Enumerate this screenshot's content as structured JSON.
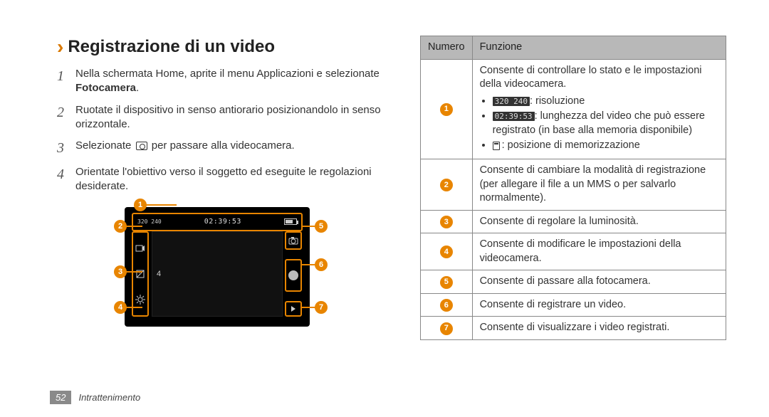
{
  "section": {
    "title": "Registrazione di un video"
  },
  "steps": [
    {
      "num": "1",
      "text_a": "Nella schermata Home, aprite il menu Applicazioni e selezionate ",
      "bold": "Fotocamera",
      "text_b": "."
    },
    {
      "num": "2",
      "text_a": "Ruotate il dispositivo in senso antiorario posizionandolo in senso orizzontale.",
      "bold": "",
      "text_b": ""
    },
    {
      "num": "3",
      "text_a": "Selezionate ",
      "icon": "camera",
      "text_b": " per passare alla videocamera."
    },
    {
      "num": "4",
      "text_a": "Orientate l'obiettivo verso il soggetto ed eseguite le regolazioni desiderate.",
      "bold": "",
      "text_b": ""
    }
  ],
  "callouts": [
    "1",
    "2",
    "3",
    "4",
    "5",
    "6",
    "7"
  ],
  "device": {
    "resolution": "320\n240",
    "time": "02:39:53",
    "exposure": "4"
  },
  "table": {
    "head_num": "Numero",
    "head_func": "Funzione",
    "rows": [
      {
        "n": "1",
        "intro": "Consente di controllare lo stato e le impostazioni della videocamera.",
        "bullets": [
          {
            "icon": "res",
            "text": ": risoluzione"
          },
          {
            "icon": "time",
            "text": ": lunghezza del video che può essere registrato (in base alla memoria disponibile)"
          },
          {
            "icon": "sd",
            "text": ": posizione di memorizzazione"
          }
        ]
      },
      {
        "n": "2",
        "intro": "Consente di cambiare la modalità di registrazione (per allegare il file a un MMS o per salvarlo normalmente)."
      },
      {
        "n": "3",
        "intro": "Consente di regolare la luminosità."
      },
      {
        "n": "4",
        "intro": "Consente di modificare le impostazioni della videocamera."
      },
      {
        "n": "5",
        "intro": "Consente di passare alla fotocamera."
      },
      {
        "n": "6",
        "intro": "Consente di registrare un video."
      },
      {
        "n": "7",
        "intro": "Consente di visualizzare i video registrati."
      }
    ]
  },
  "footer": {
    "page": "52",
    "title": "Intrattenimento"
  }
}
